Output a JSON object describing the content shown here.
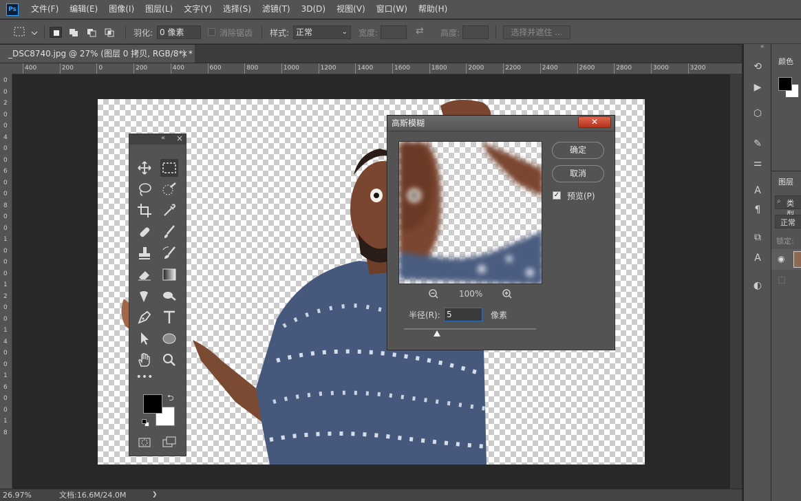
{
  "menubar": {
    "logo": "Ps",
    "items": [
      "文件(F)",
      "编辑(E)",
      "图像(I)",
      "图层(L)",
      "文字(Y)",
      "选择(S)",
      "滤镜(T)",
      "3D(D)",
      "视图(V)",
      "窗口(W)",
      "帮助(H)"
    ]
  },
  "options": {
    "feather_label": "羽化:",
    "feather_value": "0 像素",
    "antialias_label": "消除锯齿",
    "style_label": "样式:",
    "style_value": "正常",
    "width_label": "宽度:",
    "height_label": "高度:",
    "select_mask_label": "选择并遮住 ..."
  },
  "document": {
    "tab_title": "_DSC8740.jpg @ 27% (图层 0 拷贝, RGB/8*) *",
    "close": "×"
  },
  "ruler_h": [
    "400",
    "200",
    "0",
    "200",
    "400",
    "600",
    "800",
    "1000",
    "1200",
    "1400",
    "1600",
    "1800",
    "2000",
    "2200",
    "2400",
    "2600",
    "2800",
    "3000",
    "3200"
  ],
  "ruler_v": [
    "0",
    "0",
    "2",
    "0",
    "0",
    "4",
    "0",
    "0",
    "6",
    "0",
    "0",
    "8",
    "0",
    "0",
    "1",
    "0",
    "0",
    "0",
    "1",
    "2",
    "0",
    "0",
    "1",
    "4",
    "0",
    "0",
    "1",
    "6",
    "0",
    "0",
    "1",
    "8"
  ],
  "status": {
    "zoom": "26.97%",
    "doc_info": "文档:16.6M/24.0M",
    "arrow": "❯"
  },
  "panels": {
    "color_tab": "颜色",
    "layers_tab": "图层",
    "kind_label": "类型",
    "blend_mode": "正常",
    "lock_label": "锁定:"
  },
  "dialog": {
    "title": "高斯模糊",
    "ok_label": "确定",
    "cancel_label": "取消",
    "preview_label": "预览(P)",
    "preview_checked": true,
    "zoom_label": "100%",
    "radius_label": "半径(R):",
    "radius_value": "5",
    "radius_unit": "像素",
    "slider_fraction": 0.25
  },
  "colors": {
    "foreground": "#000000",
    "background": "#ffffff",
    "accent": "#31a8ff"
  }
}
